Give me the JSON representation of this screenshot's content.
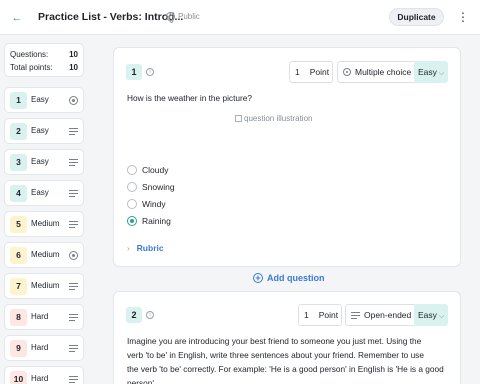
{
  "header": {
    "title": "Practice List - Verbs: Introd...",
    "visibility": "Public",
    "duplicate_label": "Duplicate"
  },
  "summary": {
    "questions_label": "Questions:",
    "questions_value": "10",
    "points_label": "Total points:",
    "points_value": "10"
  },
  "sidebar": {
    "items": [
      {
        "number": "1",
        "difficulty": "Easy",
        "type": "radio"
      },
      {
        "number": "2",
        "difficulty": "Easy",
        "type": "list"
      },
      {
        "number": "3",
        "difficulty": "Easy",
        "type": "list"
      },
      {
        "number": "4",
        "difficulty": "Easy",
        "type": "list"
      },
      {
        "number": "5",
        "difficulty": "Medium",
        "type": "list"
      },
      {
        "number": "6",
        "difficulty": "Medium",
        "type": "radio"
      },
      {
        "number": "7",
        "difficulty": "Medium",
        "type": "list"
      },
      {
        "number": "8",
        "difficulty": "Hard",
        "type": "list"
      },
      {
        "number": "9",
        "difficulty": "Hard",
        "type": "list"
      },
      {
        "number": "10",
        "difficulty": "Hard",
        "type": "list"
      }
    ]
  },
  "questions": [
    {
      "number": "1",
      "points_value": "1",
      "points_label": "Point",
      "type_label": "Multiple choice",
      "difficulty": "Easy",
      "prompt": "How is the weather in the picture?",
      "image_alt": "question illustration",
      "options": [
        "Cloudy",
        "Snowing",
        "Windy",
        "Raining"
      ],
      "selected_option": 3,
      "rubric_label": "Rubric"
    },
    {
      "number": "2",
      "points_value": "1",
      "points_label": "Point",
      "type_label": "Open-ended",
      "difficulty": "Easy",
      "prompt_lines": [
        "Imagine you are introducing your best friend to someone you just met. Using the",
        "verb 'to be' in English, write three sentences about your friend. Remember to use",
        "the verb 'to be' correctly. For example: 'He is a good person' in English is 'He is a good",
        "person'."
      ]
    }
  ],
  "add_question_label": "Add question",
  "colors": {
    "accent": "#3a7bd5",
    "easy": "#d9f2ef",
    "medium": "#fdf3cf",
    "hard": "#fde7e4",
    "selected": "#2aa58e"
  }
}
